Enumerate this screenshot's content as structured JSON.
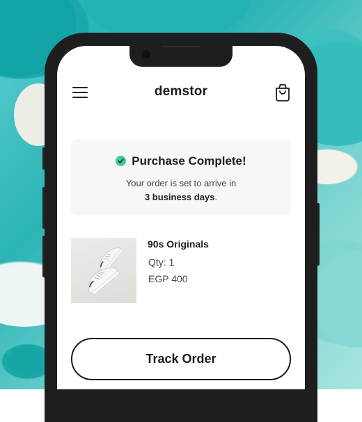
{
  "header": {
    "brand": "demstor"
  },
  "confirmation": {
    "title": "Purchase Complete!",
    "message_prefix": "Your order is set to arrive in",
    "message_highlight": "3 business days",
    "message_suffix": ".",
    "status_color": "#3ecc9a"
  },
  "order_item": {
    "name": "90s Originals",
    "quantity": "Qty: 1",
    "price": "EGP 400"
  },
  "actions": {
    "track_label": "Track Order"
  },
  "icons": {
    "menu": "hamburger-menu-icon",
    "cart": "shopping-bag-icon",
    "status": "check-circle-icon"
  }
}
